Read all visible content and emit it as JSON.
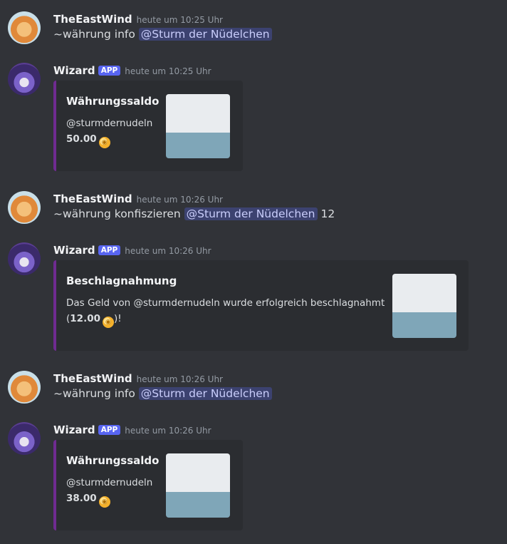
{
  "messages": [
    {
      "user": "TheEastWind",
      "time": "heute um 10:25 Uhr",
      "cmd": "~währung info",
      "mention": "@Sturm der Nüdelchen",
      "after": ""
    },
    {
      "user": "Wizard",
      "badge": "APP",
      "time": "heute um 10:25 Uhr",
      "embed": {
        "title": "Währungssaldo",
        "line1": "@sturmdernudeln",
        "amount": "50.00"
      }
    },
    {
      "user": "TheEastWind",
      "time": "heute um 10:26 Uhr",
      "cmd": "~währung konfiszieren",
      "mention": "@Sturm der Nüdelchen",
      "after": "12"
    },
    {
      "user": "Wizard",
      "badge": "APP",
      "time": "heute um 10:26 Uhr",
      "embed": {
        "title": "Beschlagnahmung",
        "line1": "Das Geld von @sturmdernudeln wurde erfolgreich beschlagnahmt",
        "line2_pre": "(",
        "amount": "12.00",
        "line2_post": ")!"
      }
    },
    {
      "user": "TheEastWind",
      "time": "heute um 10:26 Uhr",
      "cmd": "~währung info",
      "mention": "@Sturm der Nüdelchen",
      "after": ""
    },
    {
      "user": "Wizard",
      "badge": "APP",
      "time": "heute um 10:26 Uhr",
      "embed": {
        "title": "Währungssaldo",
        "line1": "@sturmdernudeln",
        "amount": "38.00"
      }
    }
  ],
  "icons": {
    "coin": "coin-icon",
    "avatar_user": "cat-avatar",
    "avatar_bot": "wizard-avatar",
    "embed_image": "pirate-image"
  },
  "colors": {
    "background": "#313338",
    "embed_bg": "#2b2d31",
    "embed_accent": "#6f2b91",
    "badge": "#5865f2",
    "mention_bg": "#3c4270"
  }
}
